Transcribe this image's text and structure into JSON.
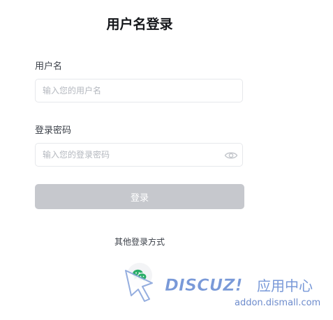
{
  "form": {
    "title": "用户名登录",
    "username": {
      "label": "用户名",
      "placeholder": "输入您的用户名",
      "value": ""
    },
    "password": {
      "label": "登录密码",
      "placeholder": "输入您的登录密码",
      "value": "",
      "toggle_icon": "eye-icon"
    },
    "submit_label": "登录",
    "submit_color": "#c6c8cd",
    "other_methods_label": "其他登录方式",
    "other_methods": [
      {
        "icon": "wechat-icon",
        "color": "#2aae67"
      }
    ]
  },
  "watermark": {
    "brand": "DISCUZ!",
    "subtitle": "应用中心",
    "url": "addon.dismall.com",
    "color": "#6b8fd4"
  }
}
